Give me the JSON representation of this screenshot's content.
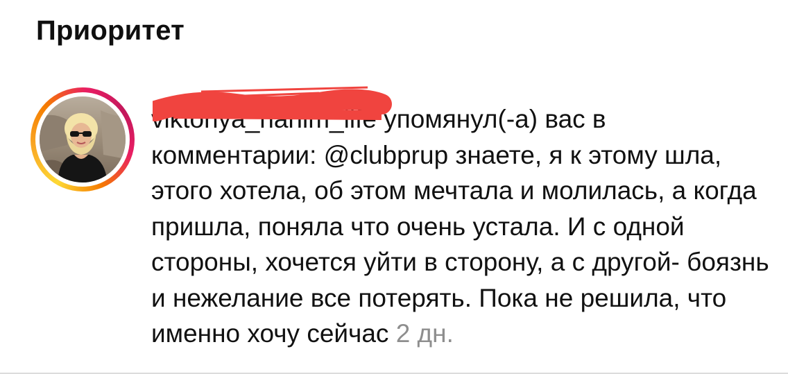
{
  "section": {
    "title": "Приоритет"
  },
  "notification": {
    "username": "viktoriya_hanim_life",
    "action": " упомянул(-а) вас в комментарии: ",
    "mention": "@clubprup",
    "comment": " знаете, я к этому шла, этого хотела, об этом мечтала и молилась, а когда пришла, поняла что очень устала. И с одной стороны, хочется уйти в сторону, а с другой- боязнь и нежелание все потерять. Пока не решила, что именно хочу сейчас",
    "timestamp": " 2 дн.",
    "avatar_icon": "user-avatar-photo",
    "ring_colors": [
      "#fdd835",
      "#f57c00",
      "#e91e63",
      "#c2185b"
    ],
    "redaction_color": "#f0443f"
  }
}
